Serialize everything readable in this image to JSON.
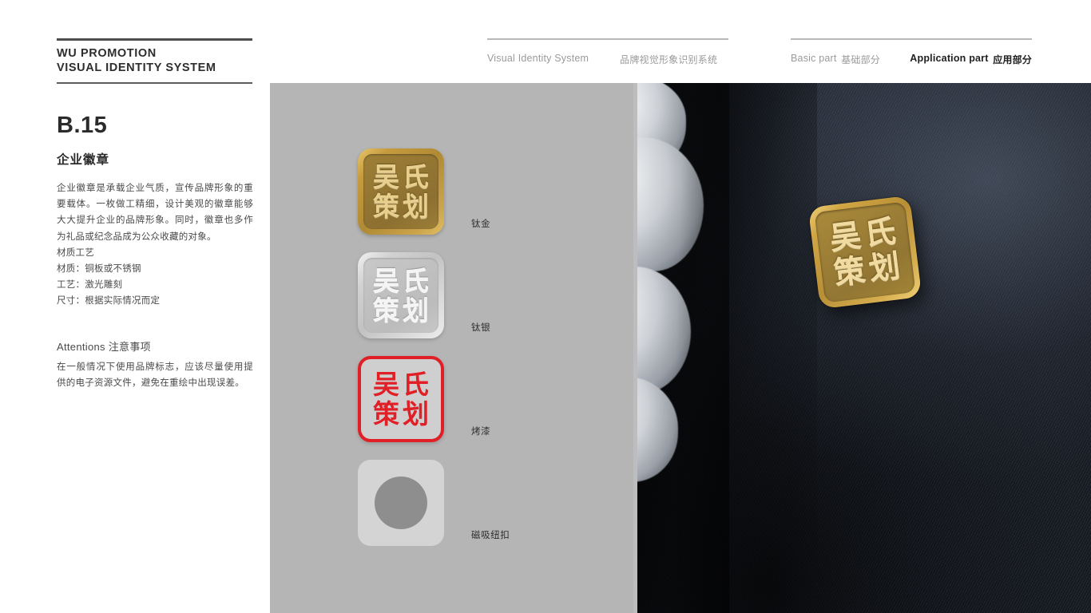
{
  "header": {
    "brand_name": "WU PROMOTION\nVISUAL IDENTITY SYSTEM",
    "nav_group_1": {
      "en": "Visual Identity System",
      "cn": "品牌视觉形象识别系统"
    },
    "nav_group_2": {
      "basic_en": "Basic part",
      "basic_cn": "基础部分",
      "application_en": "Application part",
      "application_cn": "应用部分"
    }
  },
  "left": {
    "section_code": "B.15",
    "section_title": "企业徽章",
    "body_copy": "企业徽章是承载企业气质，宣传品牌形象的重要载体。一枚做工精细，设计美观的徽章能够大大提升企业的品牌形象。同时，徽章也多作为礼品或纪念品成为公众收藏的对象。",
    "spec_list": "材质工艺\n材质：铜板或不锈钢\n工艺：激光雕刻\n尺寸：根据实际情况而定",
    "attentions_title": "Attentions 注意事项",
    "attentions_body": "在一般情况下使用品牌标志，应该尽量使用提供的电子资源文件，避免在重绘中出现误差。"
  },
  "logo": {
    "char_1": "吴",
    "char_2": "氏",
    "char_3": "策",
    "char_4": "划"
  },
  "badges": [
    {
      "id": "titanium-gold",
      "label": "钛金"
    },
    {
      "id": "titanium-silver",
      "label": "钛银"
    },
    {
      "id": "baked-enamel",
      "label": "烤漆"
    },
    {
      "id": "magnetic-button",
      "label": "磁吸纽扣"
    }
  ],
  "colors": {
    "page_background": "#ffffff",
    "swatch_panel": "#b5b5b5",
    "gold_edge": "#d0a544",
    "gold_face": "#9c7e36",
    "gold_glyph": "#e8cf8e",
    "silver_edge": "#d2d2d2",
    "silver_face": "#bfbfbf",
    "enamel_red": "#e01f26",
    "magnet_disc": "#8e8e8e",
    "fabric_navy": "#252b37",
    "rule_dark": "#4d4d4d",
    "rule_light": "#b8b8b8",
    "nav_muted": "#9a9a9a",
    "nav_active": "#1f1f1f"
  }
}
